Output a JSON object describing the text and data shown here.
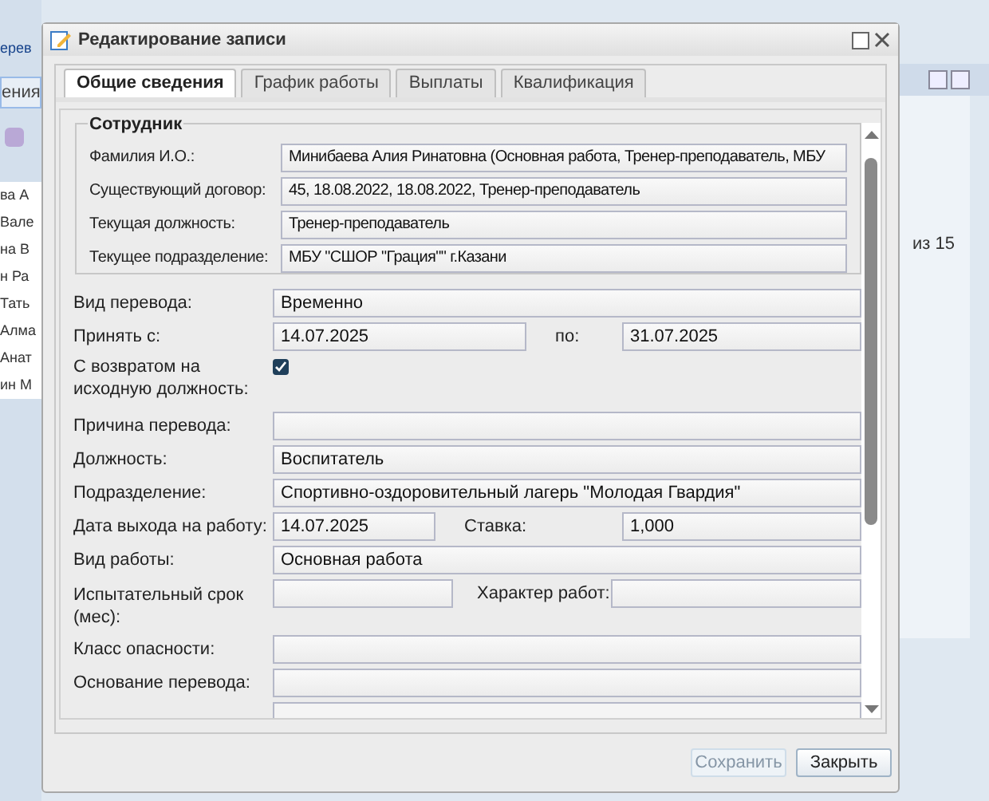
{
  "background": {
    "left_header": "ерев",
    "left_button": "ения",
    "left_rows": [
      "ва А",
      "Вале",
      "на В",
      "н Ра",
      "Тать",
      "Алма",
      "Анат",
      "ин М"
    ],
    "right_pager": "из 15"
  },
  "window": {
    "title": "Редактирование записи"
  },
  "tabs": [
    {
      "label": "Общие сведения",
      "selected": true
    },
    {
      "label": "График работы",
      "selected": false
    },
    {
      "label": "Выплаты",
      "selected": false
    },
    {
      "label": "Квалификация",
      "selected": false
    }
  ],
  "employee": {
    "legend": "Сотрудник",
    "fields": [
      {
        "label": "Фамилия И.О.:",
        "value": "Минибаева Алия Ринатовна (Основная работа, Тренер-преподаватель, МБУ"
      },
      {
        "label": "Существующий договор:",
        "value": "45, 18.08.2022, 18.08.2022, Тренер-преподаватель"
      },
      {
        "label": "Текущая должность:",
        "value": "Тренер-преподаватель"
      },
      {
        "label": "Текущее подразделение:",
        "value": "МБУ \"СШОР \"Грация\"\" г.Казани"
      }
    ]
  },
  "form": [
    {
      "kind": "field",
      "label": "Вид перевода:",
      "value": "Временно"
    },
    {
      "kind": "range",
      "label": "Принять с:",
      "value": "14.07.2025",
      "label2": "по:",
      "value2": "31.07.2025"
    },
    {
      "kind": "check",
      "label": "С возвратом на исходную должность:",
      "checked": true
    },
    {
      "kind": "field",
      "label": "Причина перевода:"
    },
    {
      "kind": "field",
      "label": "Должность:",
      "value": "Воспитатель"
    },
    {
      "kind": "field",
      "label": "Подразделение:",
      "value": "Спортивно-оздоровительный лагерь \"Молодая Гвардия\""
    },
    {
      "kind": "rate",
      "label": "Дата выхода на работу:",
      "value": "14.07.2025",
      "label2": "Ставка:",
      "value2": "1,000"
    },
    {
      "kind": "field",
      "label": "Вид работы:",
      "value": "Основная работа"
    },
    {
      "kind": "split",
      "label": "Испытательный срок (мес):",
      "label2": "Характер работ:"
    },
    {
      "kind": "field",
      "label": "Класс опасности:"
    },
    {
      "kind": "field",
      "label": "Основание перевода:"
    }
  ],
  "buttons": [
    {
      "label": "Сохранить",
      "disabled": true
    },
    {
      "label": "Закрыть",
      "disabled": false
    }
  ]
}
